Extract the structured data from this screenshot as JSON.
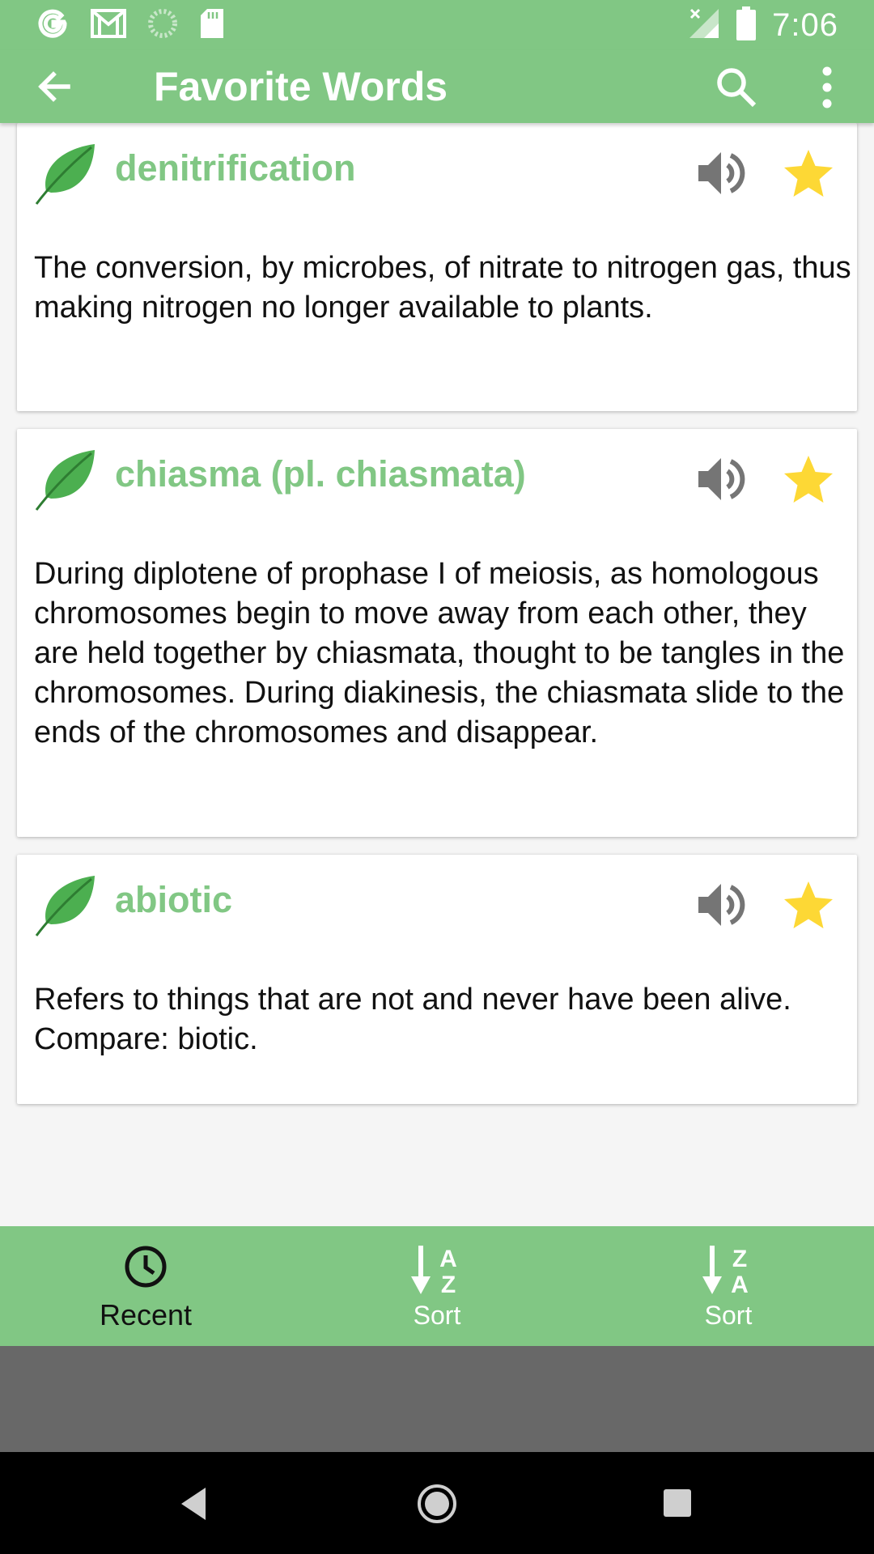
{
  "status_bar": {
    "time": "7:06",
    "left_icons": [
      "google-icon",
      "gmail-icon",
      "loading-icon",
      "sd-card-icon"
    ],
    "right_icons": [
      "no-signal-icon",
      "battery-icon"
    ]
  },
  "app_bar": {
    "title": "Favorite Words",
    "icons": [
      "back-arrow-icon",
      "search-icon",
      "more-vert-icon"
    ]
  },
  "words": [
    {
      "term": "denitrification",
      "definition": "The conversion, by microbes, of nitrate to nitrogen gas, thus making nitrogen no longer available to plants.",
      "favorite": true
    },
    {
      "term": "chiasma (pl. chiasmata)",
      "definition": "During diplotene of prophase I of meiosis, as homologous chromosomes begin to move away from each other, they are held together by chiasmata, thought to be tangles in the chromosomes. During diakinesis, the chiasmata slide to the ends of the chromosomes and disappear.",
      "favorite": true
    },
    {
      "term": "abiotic",
      "definition": "Refers to things that are not and never have been alive. Compare: biotic.",
      "favorite": true
    }
  ],
  "bottom_nav": {
    "items": [
      {
        "label": "Recent",
        "icon": "clock-icon",
        "active": true
      },
      {
        "label": "Sort",
        "icon": "sort-az-icon",
        "glyph_top": "A",
        "glyph_bottom": "Z",
        "active": false
      },
      {
        "label": "Sort",
        "icon": "sort-za-icon",
        "glyph_top": "Z",
        "glyph_bottom": "A",
        "active": false
      }
    ]
  },
  "colors": {
    "primary": "#81c784",
    "leaf": "#4caf50",
    "star": "#fdd835",
    "speaker": "#757575"
  }
}
